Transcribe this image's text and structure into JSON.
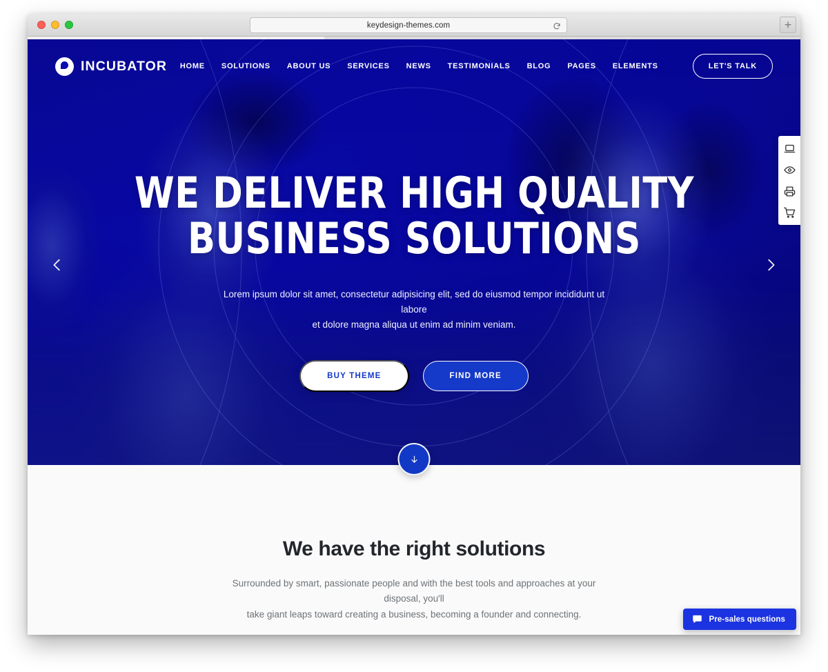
{
  "browser": {
    "url": "keydesign-themes.com",
    "reload_icon": "reload-icon",
    "new_tab_label": "+"
  },
  "nav": {
    "brand": "INCUBATOR",
    "links": [
      {
        "label": "HOME"
      },
      {
        "label": "SOLUTIONS"
      },
      {
        "label": "ABOUT US"
      },
      {
        "label": "SERVICES"
      },
      {
        "label": "NEWS"
      },
      {
        "label": "TESTIMONIALS"
      },
      {
        "label": "BLOG"
      },
      {
        "label": "PAGES"
      },
      {
        "label": "ELEMENTS"
      }
    ],
    "cta": "LET'S TALK"
  },
  "hero": {
    "title_line1": "WE DELIVER HIGH QUALITY",
    "title_line2": "BUSINESS SOLUTIONS",
    "subtitle_line1": "Lorem ipsum dolor sit amet, consectetur adipisicing elit, sed do eiusmod tempor incididunt ut labore",
    "subtitle_line2": "et dolore magna aliqua ut enim ad minim veniam.",
    "button_primary": "BUY THEME",
    "button_secondary": "FIND MORE",
    "prev_icon": "chevron-left-icon",
    "next_icon": "chevron-right-icon",
    "scroll_icon": "arrow-down-icon",
    "overlay_color": "#0b0bb6"
  },
  "tool_rail": {
    "items": [
      {
        "icon": "laptop-icon"
      },
      {
        "icon": "eye-icon"
      },
      {
        "icon": "printer-icon"
      },
      {
        "icon": "shopping-cart-icon"
      }
    ]
  },
  "section": {
    "title": "We have the right solutions",
    "text_line1": "Surrounded by smart, passionate people and with the best tools and approaches at your disposal, you'll",
    "text_line2": "take giant leaps toward creating a business, becoming a founder and connecting."
  },
  "chat": {
    "label": "Pre-sales questions",
    "icon": "chat-bubble-icon",
    "color": "#1b33e0"
  }
}
